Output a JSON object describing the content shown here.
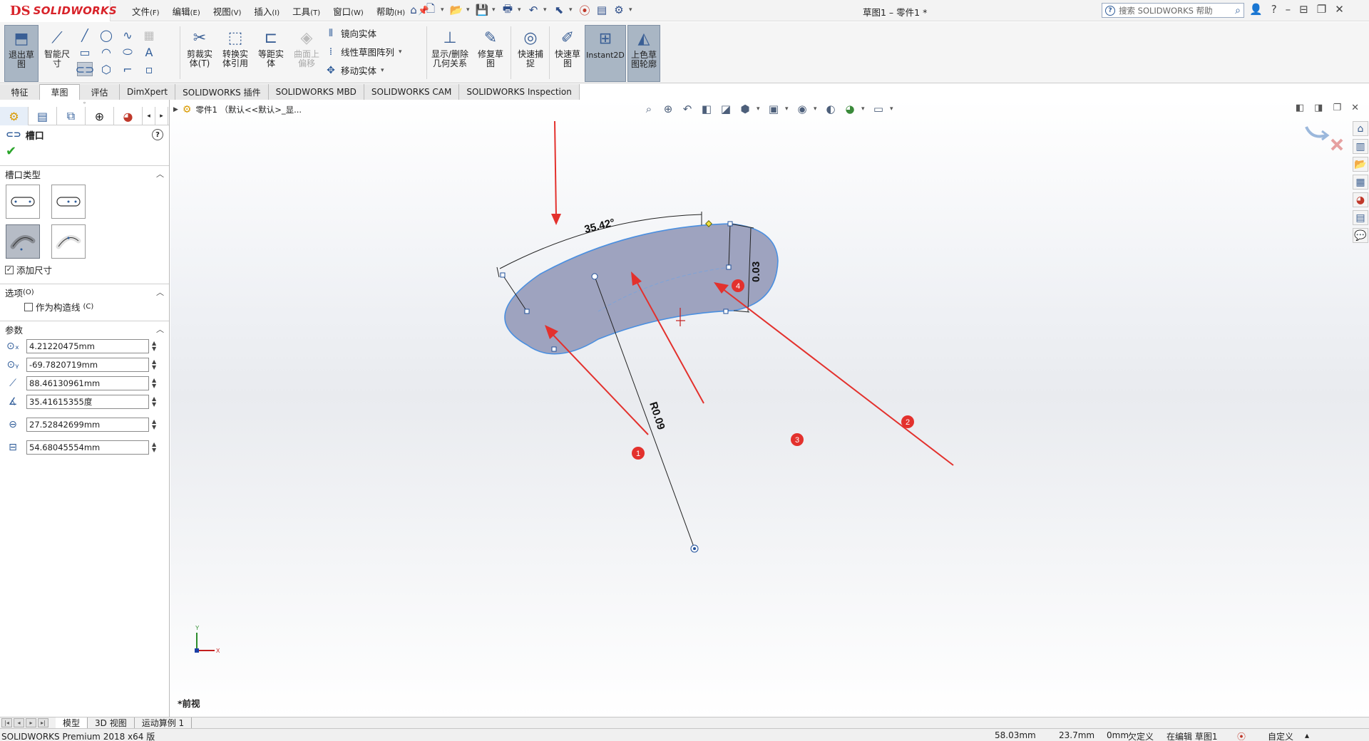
{
  "app": {
    "brand_mark": "DS",
    "brand": "SOLIDWORKS",
    "doc_title": "草图1 – 零件1 *",
    "search_placeholder": "搜索 SOLIDWORKS 帮助"
  },
  "menu": [
    {
      "label": "文件",
      "key": "(F)"
    },
    {
      "label": "编辑",
      "key": "(E)"
    },
    {
      "label": "视图",
      "key": "(V)"
    },
    {
      "label": "插入",
      "key": "(I)"
    },
    {
      "label": "工具",
      "key": "(T)"
    },
    {
      "label": "窗口",
      "key": "(W)"
    },
    {
      "label": "帮助",
      "key": "(H)"
    }
  ],
  "ribbon": {
    "exit_sketch": "退出草图",
    "smart_dim": "智能尺寸",
    "trim": "剪裁实体(T)",
    "convert": "转换实体引用",
    "offset": "等距实体",
    "surface_offset": "曲面上偏移",
    "mirror": "镜向实体",
    "linear_pattern": "线性草图阵列",
    "move": "移动实体",
    "show_delete": "显示/删除几何关系",
    "repair": "修复草图",
    "quick_snap": "快速捕捉",
    "rapid_sketch": "快速草图",
    "instant2d": "Instant2D",
    "shaded": "上色草图轮廓"
  },
  "tabs": [
    "特征",
    "草图",
    "评估",
    "DimXpert",
    "SOLIDWORKS 插件",
    "SOLIDWORKS MBD",
    "SOLIDWORKS CAM",
    "SOLIDWORKS Inspection"
  ],
  "tabs_selected": "草图",
  "property_manager": {
    "title": "槽口",
    "group_slot_type": "槽口类型",
    "add_dimensions": "添加尺寸",
    "add_dimensions_checked": true,
    "group_options": "选项",
    "group_options_key": "(O)",
    "construction": "作为构造线",
    "construction_key": "(C)",
    "construction_checked": false,
    "group_params": "参数",
    "params": [
      {
        "icon": "center-x-icon",
        "value": "4.21220475mm"
      },
      {
        "icon": "center-y-icon",
        "value": "-69.7820719mm"
      },
      {
        "icon": "radius-icon",
        "value": "88.46130961mm"
      },
      {
        "icon": "angle-icon",
        "value": "35.41615355度"
      },
      {
        "icon": "slot-width-icon",
        "value": "27.52842699mm"
      },
      {
        "icon": "slot-length-icon",
        "value": "54.68045554mm"
      }
    ]
  },
  "viewport": {
    "breadcrumb": "零件1 （默认<<默认>_显...",
    "view_name": "*前视",
    "dim_angle": "35.42°",
    "dim_width": "0.03",
    "dim_radius": "R0.09",
    "callouts": [
      "1",
      "2",
      "3",
      "4"
    ],
    "accent_red": "#e3312d",
    "slot_fill": "#9ea3bf",
    "slot_edge": "#4a8fe0"
  },
  "bottom_tabs": [
    "模型",
    "3D 视图",
    "运动算例 1"
  ],
  "status": {
    "edition": "SOLIDWORKS Premium 2018 x64 版",
    "x": "58.03mm",
    "y": "23.7mm",
    "z": "0mm",
    "defined": "欠定义",
    "editing": "在编辑 草图1",
    "units": "自定义"
  }
}
